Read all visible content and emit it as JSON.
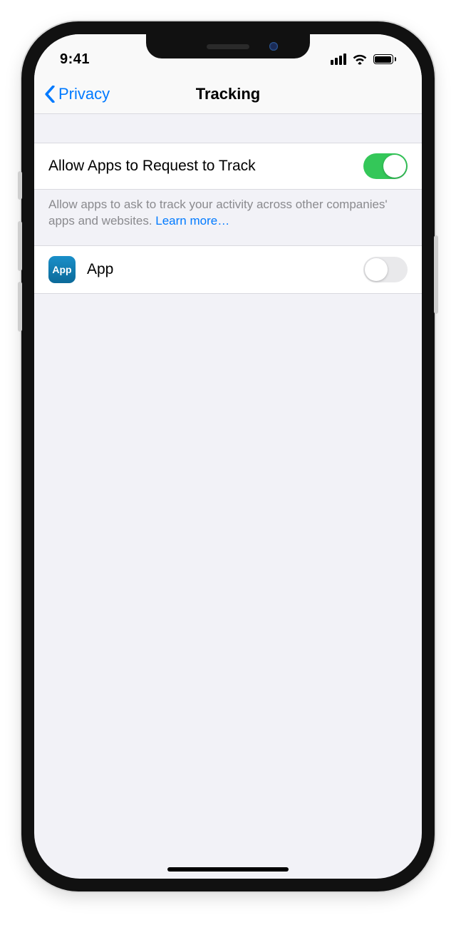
{
  "status": {
    "time": "9:41"
  },
  "nav": {
    "back_label": "Privacy",
    "title": "Tracking"
  },
  "settings": {
    "allow_tracking": {
      "label": "Allow Apps to Request to Track",
      "enabled": true
    },
    "footer_text": "Allow apps to ask to track your activity across other companies' apps and websites. ",
    "learn_more": "Learn more…"
  },
  "apps": [
    {
      "name": "App",
      "icon_text": "App",
      "enabled": false
    }
  ]
}
